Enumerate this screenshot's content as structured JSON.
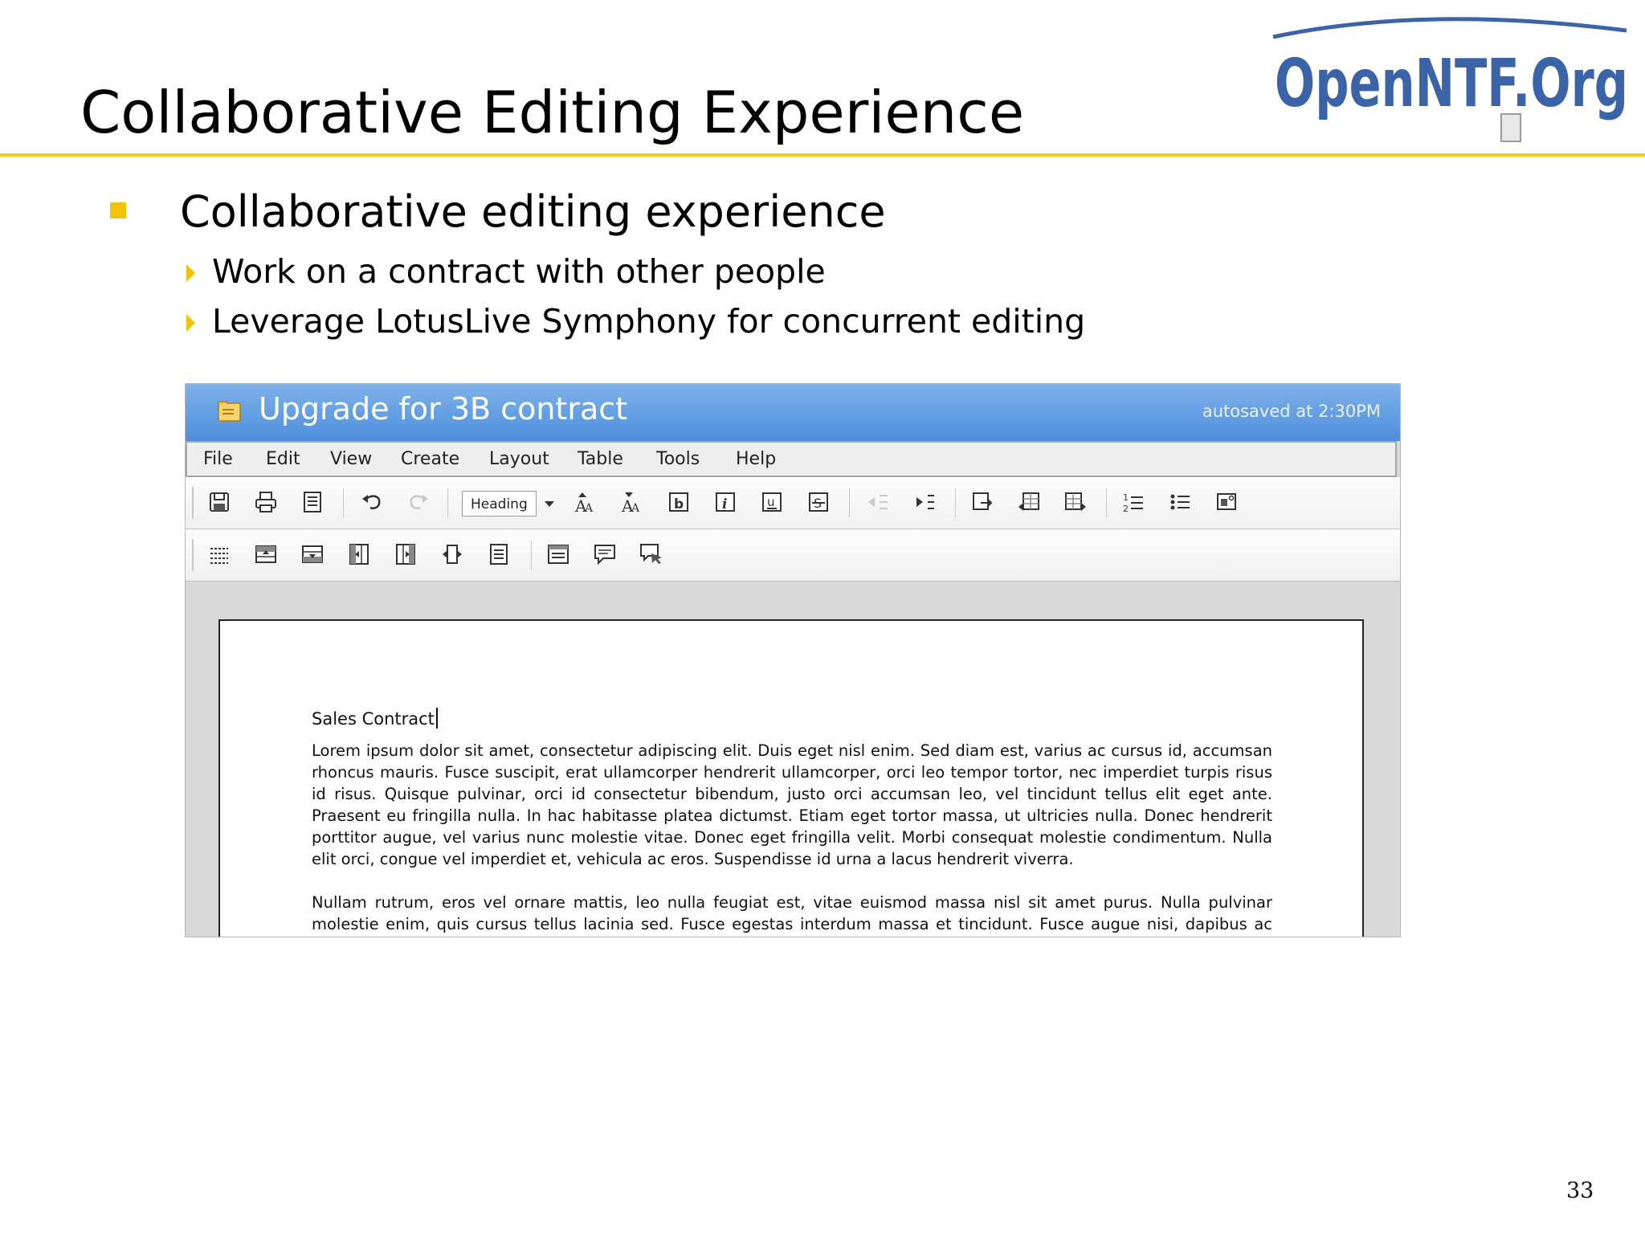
{
  "slide": {
    "title": "Collaborative Editing Experience",
    "logo_text": "OpenNTF.Org",
    "bullets": [
      {
        "text": "Collaborative editing experience",
        "sub": [
          "Work on a contract with other people",
          "Leverage LotusLive Symphony for concurrent editing"
        ]
      }
    ],
    "page_number": "33",
    "colors": {
      "accent": "#f2cc19",
      "logo_blue": "#3b64a8"
    }
  },
  "app": {
    "document_title": "Upgrade for 3B contract",
    "autosave_status": "autosaved at 2:30PM",
    "title_bar_color": "#5a96de",
    "menu": [
      "File",
      "Edit",
      "View",
      "Create",
      "Layout",
      "Table",
      "Tools",
      "Help"
    ],
    "toolbar1": {
      "style_select_value": "Heading",
      "icons": [
        "save-icon",
        "print-icon",
        "page-setup-icon",
        "undo-icon",
        "redo-icon",
        "grow-font-icon",
        "shrink-font-icon",
        "bold-icon",
        "italic-icon",
        "underline-icon",
        "strikethrough-icon",
        "decrease-indent-icon",
        "increase-indent-icon",
        "insert-image-icon",
        "table-icon",
        "table-properties-icon",
        "numbered-list-icon",
        "bullet-list-icon",
        "image-properties-icon"
      ]
    },
    "toolbar2": {
      "icons": [
        "table-grid-icon",
        "insert-row-above-icon",
        "insert-row-below-icon",
        "insert-column-left-icon",
        "insert-column-right-icon",
        "split-cell-icon",
        "align-block-icon",
        "paragraph-icon",
        "comment-icon",
        "comments-icon"
      ]
    },
    "document": {
      "heading": "Sales Contract",
      "paragraphs": [
        "Lorem ipsum dolor sit amet, consectetur adipiscing elit. Duis eget nisl enim. Sed diam est, varius ac cursus id, accumsan rhoncus mauris. Fusce suscipit, erat ullamcorper hendrerit ullamcorper, orci leo tempor tortor, nec imperdiet turpis risus id risus. Quisque pulvinar, orci id consectetur bibendum, justo orci accumsan leo, vel tincidunt tellus elit eget ante. Praesent eu fringilla nulla. In hac habitasse platea dictumst. Etiam eget tortor massa, ut ultricies nulla. Donec hendrerit porttitor augue, vel varius nunc molestie vitae. Donec eget fringilla velit. Morbi consequat molestie condimentum. Nulla elit orci, congue vel imperdiet et, vehicula ac eros. Suspendisse id urna a lacus hendrerit viverra.",
        "Nullam rutrum, eros vel ornare mattis, leo nulla feugiat est, vitae euismod massa nisl sit amet purus. Nulla pulvinar molestie enim, quis cursus tellus lacinia sed. Fusce egestas interdum massa et tincidunt. Fusce augue nisi, dapibus ac consectetur sit amet."
      ]
    }
  }
}
